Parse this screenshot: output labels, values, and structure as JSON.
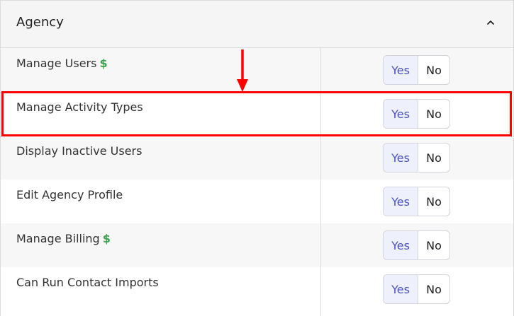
{
  "section": {
    "title": "Agency"
  },
  "rows": [
    {
      "label": "Manage Users",
      "paid": "$",
      "yes": "Yes",
      "no": "No"
    },
    {
      "label": "Manage Activity Types",
      "paid": "",
      "yes": "Yes",
      "no": "No"
    },
    {
      "label": "Display Inactive Users",
      "paid": "",
      "yes": "Yes",
      "no": "No"
    },
    {
      "label": "Edit Agency Profile",
      "paid": "",
      "yes": "Yes",
      "no": "No"
    },
    {
      "label": "Manage Billing",
      "paid": "$",
      "yes": "Yes",
      "no": "No"
    },
    {
      "label": "Can Run Contact Imports",
      "paid": "",
      "yes": "Yes",
      "no": "No"
    }
  ],
  "icons": {
    "collapse": "chevron-up-icon",
    "annotation_arrow": "down-arrow-icon"
  },
  "colors": {
    "accent": "#4a52c8",
    "paid_indicator": "#3fa34d",
    "annotation": "#ff0000"
  }
}
